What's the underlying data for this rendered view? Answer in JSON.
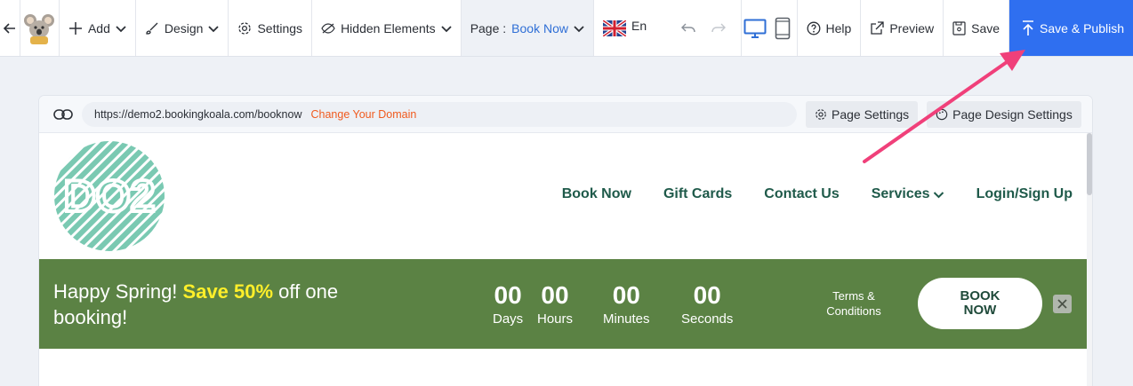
{
  "toolbar": {
    "add_label": "Add",
    "design_label": "Design",
    "settings_label": "Settings",
    "hidden_label": "Hidden Elements",
    "page_prefix": "Page :",
    "page_value": "Book Now",
    "lang_label": "En",
    "help_label": "Help",
    "preview_label": "Preview",
    "save_label": "Save",
    "publish_label": "Save & Publish",
    "accent_color": "#2f6ff0",
    "device_active_color": "#2f6fd6"
  },
  "address_bar": {
    "url": "https://demo2.bookingkoala.com/booknow",
    "change_domain": "Change Your Domain",
    "page_settings": "Page Settings",
    "page_design_settings": "Page Design Settings"
  },
  "site": {
    "logo_text": "DO2",
    "logo_color": "#7ac9b2",
    "nav": [
      "Book Now",
      "Gift Cards",
      "Contact Us",
      "Services",
      "Login/Sign Up"
    ],
    "nav_color": "#1f5a4a"
  },
  "banner": {
    "bg_color": "#5b8244",
    "promo_before": "Happy Spring! ",
    "promo_highlight": "Save 50%",
    "promo_after": " off one booking!",
    "highlight_color": "#ffef2a",
    "timer": [
      {
        "num": "00",
        "label": "Days"
      },
      {
        "num": "00",
        "label": "Hours"
      },
      {
        "num": "00",
        "label": "Minutes"
      },
      {
        "num": "00",
        "label": "Seconds"
      }
    ],
    "terms": "Terms & Conditions",
    "book_button": "BOOK NOW"
  },
  "annotation": {
    "color": "#f0407a"
  }
}
